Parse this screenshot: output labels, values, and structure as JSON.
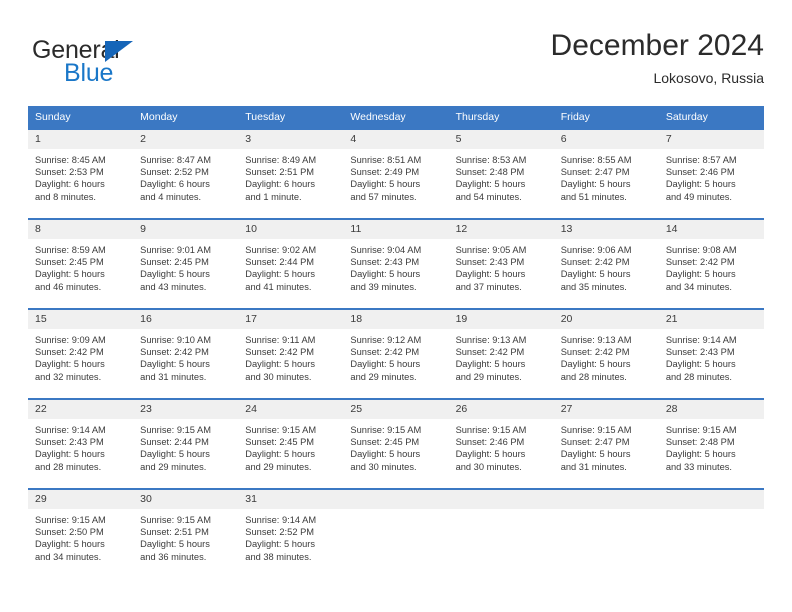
{
  "brand": {
    "name_part1": "General",
    "name_part2": "Blue",
    "triangle_color": "#1565b8",
    "blue_color": "#1a77c8"
  },
  "header": {
    "title": "December 2024",
    "subtitle": "Lokosovo, Russia"
  },
  "theme": {
    "header_bg": "#3b78c3",
    "daynum_bg": "#f0f0f0",
    "text": "#3b3b3b"
  },
  "weekdays": [
    "Sunday",
    "Monday",
    "Tuesday",
    "Wednesday",
    "Thursday",
    "Friday",
    "Saturday"
  ],
  "weeks": [
    [
      {
        "day": "1",
        "sunrise": "Sunrise: 8:45 AM",
        "sunset": "Sunset: 2:53 PM",
        "daylight_line1": "Daylight: 6 hours",
        "daylight_line2": "and 8 minutes."
      },
      {
        "day": "2",
        "sunrise": "Sunrise: 8:47 AM",
        "sunset": "Sunset: 2:52 PM",
        "daylight_line1": "Daylight: 6 hours",
        "daylight_line2": "and 4 minutes."
      },
      {
        "day": "3",
        "sunrise": "Sunrise: 8:49 AM",
        "sunset": "Sunset: 2:51 PM",
        "daylight_line1": "Daylight: 6 hours",
        "daylight_line2": "and 1 minute."
      },
      {
        "day": "4",
        "sunrise": "Sunrise: 8:51 AM",
        "sunset": "Sunset: 2:49 PM",
        "daylight_line1": "Daylight: 5 hours",
        "daylight_line2": "and 57 minutes."
      },
      {
        "day": "5",
        "sunrise": "Sunrise: 8:53 AM",
        "sunset": "Sunset: 2:48 PM",
        "daylight_line1": "Daylight: 5 hours",
        "daylight_line2": "and 54 minutes."
      },
      {
        "day": "6",
        "sunrise": "Sunrise: 8:55 AM",
        "sunset": "Sunset: 2:47 PM",
        "daylight_line1": "Daylight: 5 hours",
        "daylight_line2": "and 51 minutes."
      },
      {
        "day": "7",
        "sunrise": "Sunrise: 8:57 AM",
        "sunset": "Sunset: 2:46 PM",
        "daylight_line1": "Daylight: 5 hours",
        "daylight_line2": "and 49 minutes."
      }
    ],
    [
      {
        "day": "8",
        "sunrise": "Sunrise: 8:59 AM",
        "sunset": "Sunset: 2:45 PM",
        "daylight_line1": "Daylight: 5 hours",
        "daylight_line2": "and 46 minutes."
      },
      {
        "day": "9",
        "sunrise": "Sunrise: 9:01 AM",
        "sunset": "Sunset: 2:45 PM",
        "daylight_line1": "Daylight: 5 hours",
        "daylight_line2": "and 43 minutes."
      },
      {
        "day": "10",
        "sunrise": "Sunrise: 9:02 AM",
        "sunset": "Sunset: 2:44 PM",
        "daylight_line1": "Daylight: 5 hours",
        "daylight_line2": "and 41 minutes."
      },
      {
        "day": "11",
        "sunrise": "Sunrise: 9:04 AM",
        "sunset": "Sunset: 2:43 PM",
        "daylight_line1": "Daylight: 5 hours",
        "daylight_line2": "and 39 minutes."
      },
      {
        "day": "12",
        "sunrise": "Sunrise: 9:05 AM",
        "sunset": "Sunset: 2:43 PM",
        "daylight_line1": "Daylight: 5 hours",
        "daylight_line2": "and 37 minutes."
      },
      {
        "day": "13",
        "sunrise": "Sunrise: 9:06 AM",
        "sunset": "Sunset: 2:42 PM",
        "daylight_line1": "Daylight: 5 hours",
        "daylight_line2": "and 35 minutes."
      },
      {
        "day": "14",
        "sunrise": "Sunrise: 9:08 AM",
        "sunset": "Sunset: 2:42 PM",
        "daylight_line1": "Daylight: 5 hours",
        "daylight_line2": "and 34 minutes."
      }
    ],
    [
      {
        "day": "15",
        "sunrise": "Sunrise: 9:09 AM",
        "sunset": "Sunset: 2:42 PM",
        "daylight_line1": "Daylight: 5 hours",
        "daylight_line2": "and 32 minutes."
      },
      {
        "day": "16",
        "sunrise": "Sunrise: 9:10 AM",
        "sunset": "Sunset: 2:42 PM",
        "daylight_line1": "Daylight: 5 hours",
        "daylight_line2": "and 31 minutes."
      },
      {
        "day": "17",
        "sunrise": "Sunrise: 9:11 AM",
        "sunset": "Sunset: 2:42 PM",
        "daylight_line1": "Daylight: 5 hours",
        "daylight_line2": "and 30 minutes."
      },
      {
        "day": "18",
        "sunrise": "Sunrise: 9:12 AM",
        "sunset": "Sunset: 2:42 PM",
        "daylight_line1": "Daylight: 5 hours",
        "daylight_line2": "and 29 minutes."
      },
      {
        "day": "19",
        "sunrise": "Sunrise: 9:13 AM",
        "sunset": "Sunset: 2:42 PM",
        "daylight_line1": "Daylight: 5 hours",
        "daylight_line2": "and 29 minutes."
      },
      {
        "day": "20",
        "sunrise": "Sunrise: 9:13 AM",
        "sunset": "Sunset: 2:42 PM",
        "daylight_line1": "Daylight: 5 hours",
        "daylight_line2": "and 28 minutes."
      },
      {
        "day": "21",
        "sunrise": "Sunrise: 9:14 AM",
        "sunset": "Sunset: 2:43 PM",
        "daylight_line1": "Daylight: 5 hours",
        "daylight_line2": "and 28 minutes."
      }
    ],
    [
      {
        "day": "22",
        "sunrise": "Sunrise: 9:14 AM",
        "sunset": "Sunset: 2:43 PM",
        "daylight_line1": "Daylight: 5 hours",
        "daylight_line2": "and 28 minutes."
      },
      {
        "day": "23",
        "sunrise": "Sunrise: 9:15 AM",
        "sunset": "Sunset: 2:44 PM",
        "daylight_line1": "Daylight: 5 hours",
        "daylight_line2": "and 29 minutes."
      },
      {
        "day": "24",
        "sunrise": "Sunrise: 9:15 AM",
        "sunset": "Sunset: 2:45 PM",
        "daylight_line1": "Daylight: 5 hours",
        "daylight_line2": "and 29 minutes."
      },
      {
        "day": "25",
        "sunrise": "Sunrise: 9:15 AM",
        "sunset": "Sunset: 2:45 PM",
        "daylight_line1": "Daylight: 5 hours",
        "daylight_line2": "and 30 minutes."
      },
      {
        "day": "26",
        "sunrise": "Sunrise: 9:15 AM",
        "sunset": "Sunset: 2:46 PM",
        "daylight_line1": "Daylight: 5 hours",
        "daylight_line2": "and 30 minutes."
      },
      {
        "day": "27",
        "sunrise": "Sunrise: 9:15 AM",
        "sunset": "Sunset: 2:47 PM",
        "daylight_line1": "Daylight: 5 hours",
        "daylight_line2": "and 31 minutes."
      },
      {
        "day": "28",
        "sunrise": "Sunrise: 9:15 AM",
        "sunset": "Sunset: 2:48 PM",
        "daylight_line1": "Daylight: 5 hours",
        "daylight_line2": "and 33 minutes."
      }
    ],
    [
      {
        "day": "29",
        "sunrise": "Sunrise: 9:15 AM",
        "sunset": "Sunset: 2:50 PM",
        "daylight_line1": "Daylight: 5 hours",
        "daylight_line2": "and 34 minutes."
      },
      {
        "day": "30",
        "sunrise": "Sunrise: 9:15 AM",
        "sunset": "Sunset: 2:51 PM",
        "daylight_line1": "Daylight: 5 hours",
        "daylight_line2": "and 36 minutes."
      },
      {
        "day": "31",
        "sunrise": "Sunrise: 9:14 AM",
        "sunset": "Sunset: 2:52 PM",
        "daylight_line1": "Daylight: 5 hours",
        "daylight_line2": "and 38 minutes."
      },
      {
        "day": "",
        "sunrise": "",
        "sunset": "",
        "daylight_line1": "",
        "daylight_line2": ""
      },
      {
        "day": "",
        "sunrise": "",
        "sunset": "",
        "daylight_line1": "",
        "daylight_line2": ""
      },
      {
        "day": "",
        "sunrise": "",
        "sunset": "",
        "daylight_line1": "",
        "daylight_line2": ""
      },
      {
        "day": "",
        "sunrise": "",
        "sunset": "",
        "daylight_line1": "",
        "daylight_line2": ""
      }
    ]
  ]
}
